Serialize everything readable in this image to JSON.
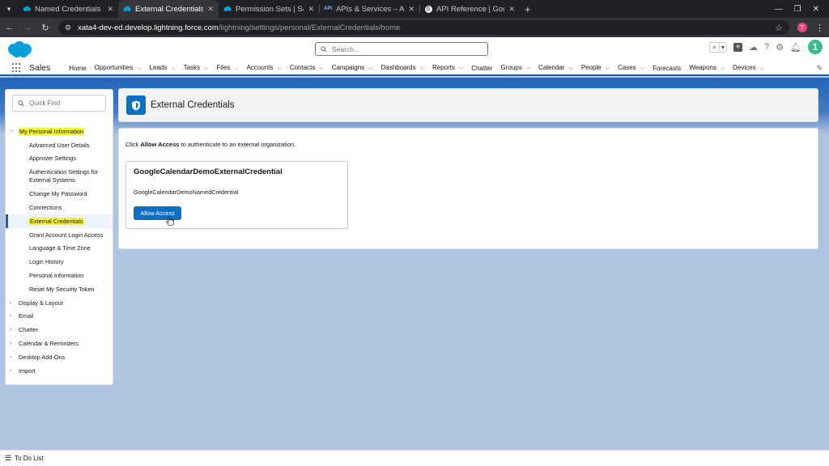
{
  "browser": {
    "tabs": [
      {
        "title": "Named Credentials | Sa",
        "icon": "salesforce-cloud-icon",
        "active": false
      },
      {
        "title": "External Credentials | S",
        "icon": "salesforce-cloud-icon",
        "active": true
      },
      {
        "title": "Permission Sets | Salesf",
        "icon": "salesforce-cloud-icon",
        "active": false
      },
      {
        "title": "APIs & Services – APIs &",
        "icon": "api-icon",
        "active": false
      },
      {
        "title": "API Reference  |  Googl",
        "icon": "google-icon",
        "active": false
      }
    ],
    "url_host": "xata4-dev-ed.develop.lightning.force.com",
    "url_path": "/lightning/settings/personal/ExternalCredentials/home",
    "profile_initial": "T"
  },
  "header": {
    "search_placeholder": "Search...",
    "user_badge": "1"
  },
  "nav": {
    "app_name": "Sales",
    "items": [
      {
        "label": "Home",
        "chevron": false
      },
      {
        "label": "Opportunities",
        "chevron": true
      },
      {
        "label": "Leads",
        "chevron": true
      },
      {
        "label": "Tasks",
        "chevron": true
      },
      {
        "label": "Files",
        "chevron": true
      },
      {
        "label": "Accounts",
        "chevron": true
      },
      {
        "label": "Contacts",
        "chevron": true
      },
      {
        "label": "Campaigns",
        "chevron": true
      },
      {
        "label": "Dashboards",
        "chevron": true
      },
      {
        "label": "Reports",
        "chevron": true
      },
      {
        "label": "Chatter",
        "chevron": false
      },
      {
        "label": "Groups",
        "chevron": true
      },
      {
        "label": "Calendar",
        "chevron": true
      },
      {
        "label": "People",
        "chevron": true
      },
      {
        "label": "Cases",
        "chevron": true
      },
      {
        "label": "Forecasts",
        "chevron": false
      },
      {
        "label": "Weapons",
        "chevron": true
      },
      {
        "label": "Devices",
        "chevron": true
      }
    ]
  },
  "sidebar": {
    "quick_find_placeholder": "Quick Find",
    "sections": [
      {
        "label": "My Personal Information",
        "expanded": true,
        "highlight": true,
        "children": [
          {
            "label": "Advanced User Details"
          },
          {
            "label": "Approver Settings"
          },
          {
            "label": "Authentication Settings for External Systems",
            "tall": true
          },
          {
            "label": "Change My Password"
          },
          {
            "label": "Connections"
          },
          {
            "label": "External Credentials",
            "selected": true,
            "highlight": true
          },
          {
            "label": "Grant Account Login Access"
          },
          {
            "label": "Language & Time Zone"
          },
          {
            "label": "Login History"
          },
          {
            "label": "Personal Information"
          },
          {
            "label": "Reset My Security Token"
          }
        ]
      },
      {
        "label": "Display & Layout",
        "expanded": false
      },
      {
        "label": "Email",
        "expanded": false
      },
      {
        "label": "Chatter",
        "expanded": false
      },
      {
        "label": "Calendar & Reminders",
        "expanded": false
      },
      {
        "label": "Desktop Add-Ons",
        "expanded": false
      },
      {
        "label": "Import",
        "expanded": false
      }
    ]
  },
  "page": {
    "title": "External Credentials",
    "instruction_prefix": "Click ",
    "instruction_bold": "Allow Access",
    "instruction_suffix": " to authenticate to an external organization.",
    "credential": {
      "title": "GoogleCalendarDemoExternalCredential",
      "named_credential": "GoogleCalendarDemoNamedCredential",
      "button_label": "Allow Access"
    }
  },
  "utility": {
    "todo_label": "To Do List"
  },
  "colors": {
    "brand_blue": "#0b6fc2",
    "nav_underline": "#1b5fb5",
    "highlight": "#f5f52c",
    "user_avatar": "#3bba8c"
  }
}
